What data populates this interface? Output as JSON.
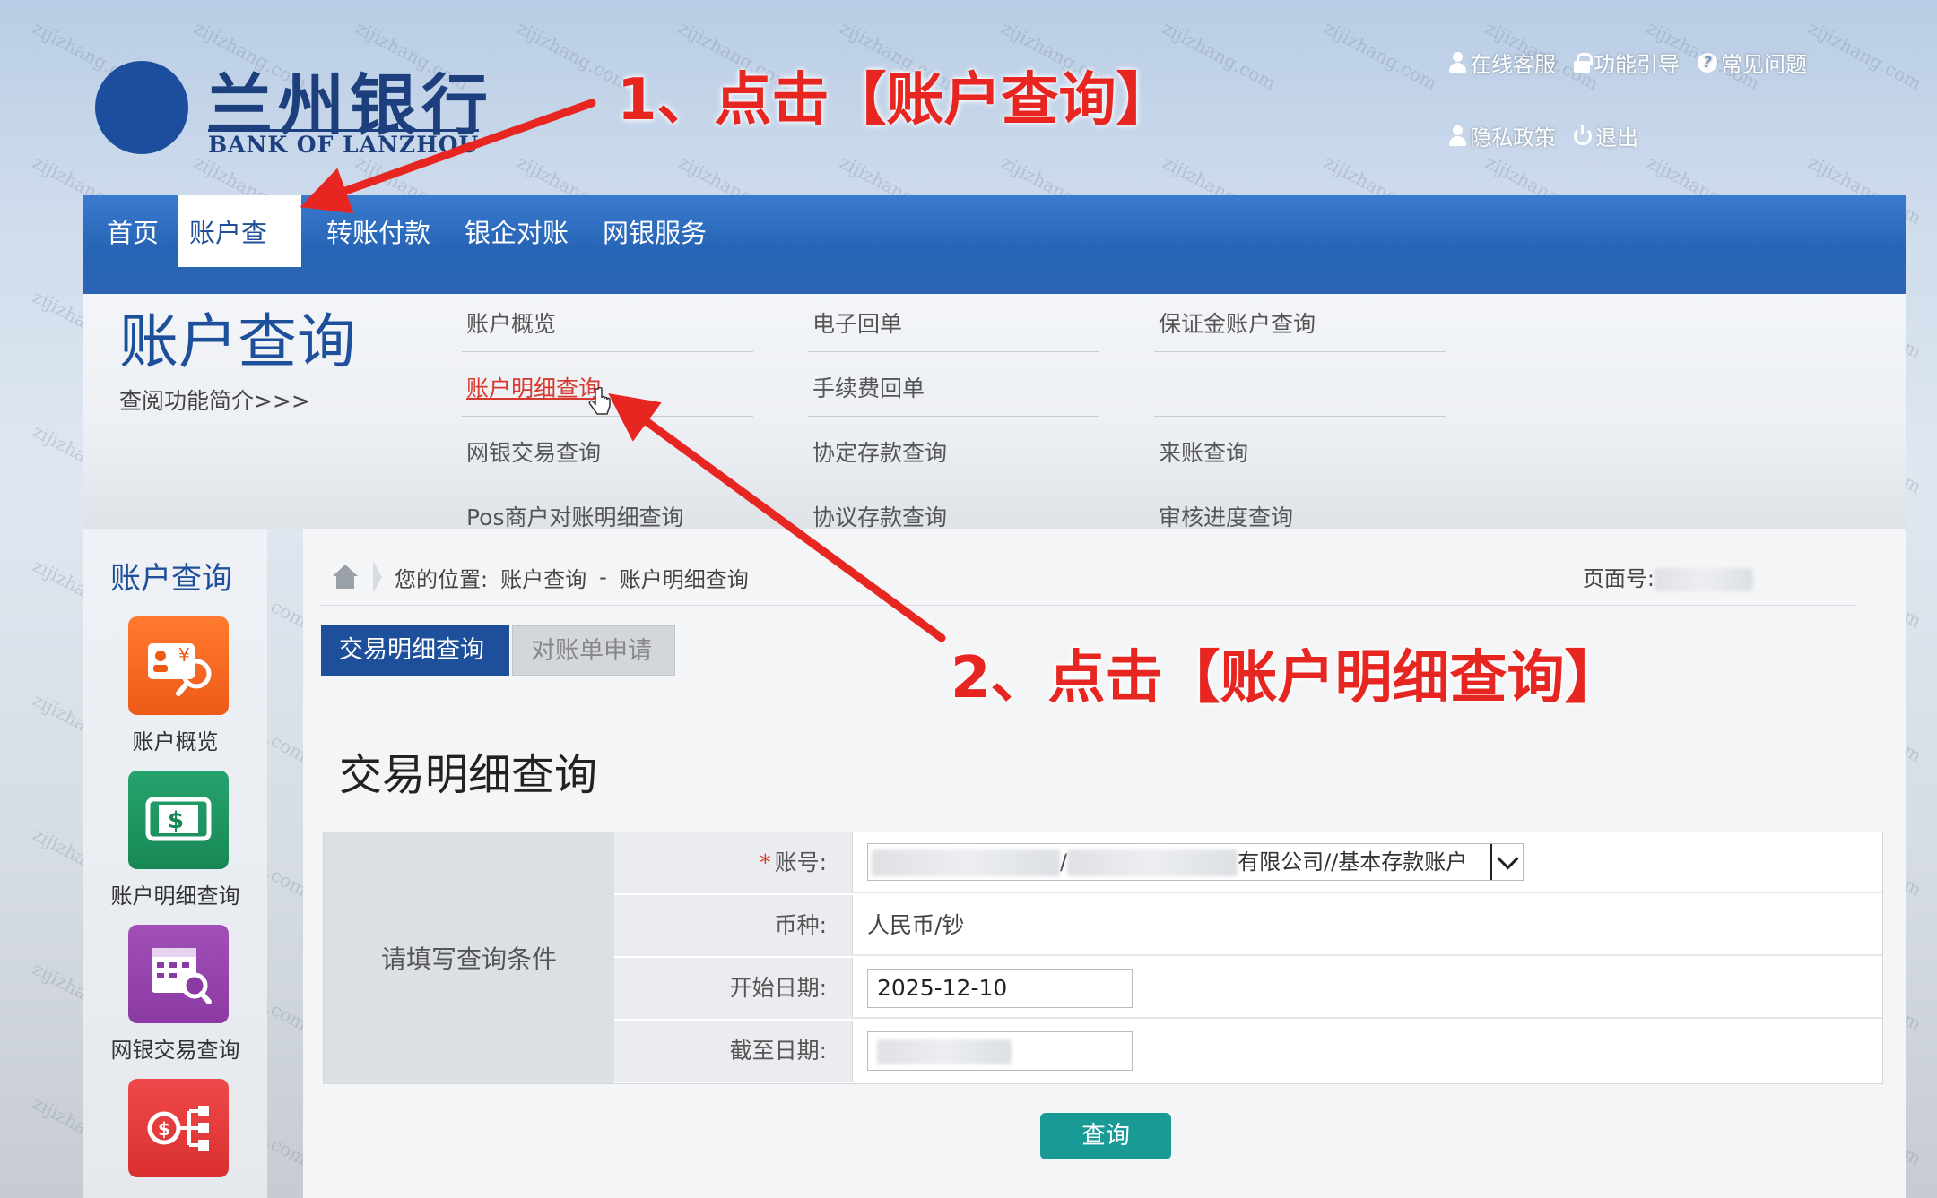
{
  "logo": {
    "cn": "兰州银行",
    "en": "BANK OF LANZHOU"
  },
  "toplinks": {
    "online_service": "在线客服",
    "function_guide": "功能引导",
    "faq": "常见问题",
    "privacy": "隐私政策",
    "logout": "退出"
  },
  "nav": [
    "首页",
    "账户查询",
    "转账付款",
    "银企对账",
    "网银服务"
  ],
  "mega": {
    "title": "账户查询",
    "intro": "查阅功能简介>>>",
    "col1": [
      "账户概览",
      "账户明细查询",
      "网银交易查询",
      "Pos商户对账明细查询"
    ],
    "col2": [
      "电子回单",
      "手续费回单",
      "协定存款查询",
      "协议存款查询"
    ],
    "col3": [
      "保证金账户查询",
      "来账查询",
      "审核进度查询"
    ]
  },
  "sidebar": {
    "title": "账户查询",
    "items": [
      "账户概览",
      "账户明细查询",
      "网银交易查询"
    ]
  },
  "breadcrumb": {
    "prefix": "您的位置:",
    "level1": "账户查询",
    "sep": "-",
    "level2": "账户明细查询"
  },
  "page_no_label": "页面号:",
  "tabs": {
    "active": "交易明细查询",
    "inactive": "对账单申请"
  },
  "form": {
    "title": "交易明细查询",
    "section_label": "请填写查询条件",
    "account_label": "账号:",
    "account_value_sep": "/",
    "account_value_tail": "有限公司//基本存款账户",
    "currency_label": "币种:",
    "currency_value": "人民币/钞",
    "start_label": "开始日期:",
    "start_value": "2025-12-10",
    "end_label": "截至日期:"
  },
  "query_button": "查询",
  "annotations": {
    "step1": "1、点击【账户查询】",
    "step2": "2、点击【账户明细查询】"
  },
  "watermark": "zijizhang.com",
  "colors": {
    "nav_blue": "#2764b5",
    "brand_blue": "#1e4f9a",
    "annotation_red": "#e82621",
    "query_teal": "#1a9a95"
  }
}
